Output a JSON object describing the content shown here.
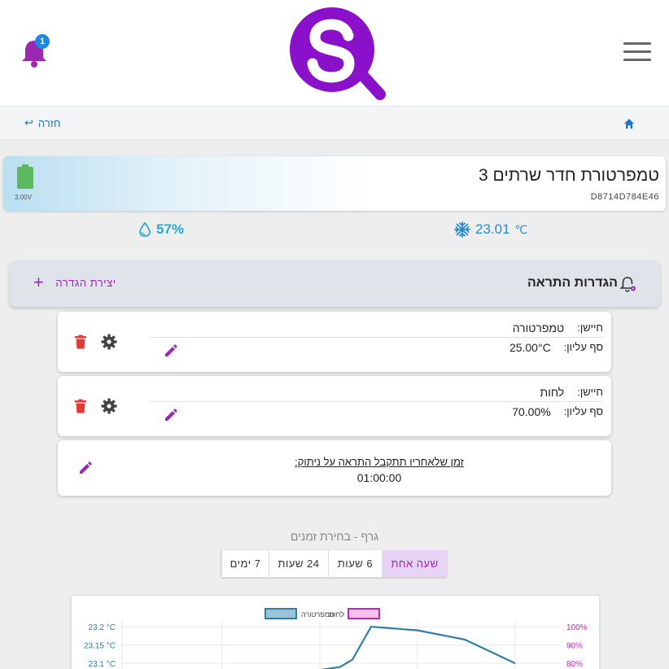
{
  "header": {
    "notification_count": "1",
    "logo_letter": "S"
  },
  "breadcrumb": {
    "back_label": "חזרה",
    "back_arrow": "↩"
  },
  "device": {
    "title": "טמפרטורת חדר שרתים 3",
    "id": "D8714D784E46",
    "battery_voltage": "3.00V",
    "battery_level": 0.9
  },
  "readings": {
    "temperature_value": "23.01",
    "temperature_unit": "℃",
    "humidity_value": "57%"
  },
  "alerts": {
    "title": "הגדרות התראה",
    "create_label": "יצירת הגדרה",
    "rules": [
      {
        "sensor_label": "חיישן:",
        "sensor_value": "טמפרטורה",
        "limit_label": "סף עליון:",
        "limit_value": "25.00°C"
      },
      {
        "sensor_label": "חיישן:",
        "sensor_value": "לחות",
        "limit_label": "סף עליון:",
        "limit_value": "70.00%"
      }
    ],
    "timeout_label": "זמן שלאחריו תתקבל התראה על ניתוק:",
    "timeout_value": "01:00:00"
  },
  "graph": {
    "title": "גרף - בחירת זמנים",
    "ranges": [
      "שעה אחת",
      "6 שעות",
      "24 שעות",
      "7 ימים"
    ],
    "active_range": "שעה אחת"
  },
  "chart_data": {
    "type": "line",
    "legend": [
      "לחות",
      "טמפרטורה"
    ],
    "y_left_ticks": [
      "23.2 °C",
      "23.15 °C",
      "23.1 °C"
    ],
    "y_right_ticks": [
      "100%",
      "90%",
      "80%"
    ],
    "series": [
      {
        "name": "טמפרטורה",
        "color": "#2e7ea6",
        "values": [
          23.08,
          23.09,
          23.11,
          23.2,
          23.19,
          23.165,
          23.1
        ]
      }
    ]
  },
  "colors": {
    "accent": "#9c27b0",
    "link": "#1976d2",
    "delete": "#e53935"
  }
}
